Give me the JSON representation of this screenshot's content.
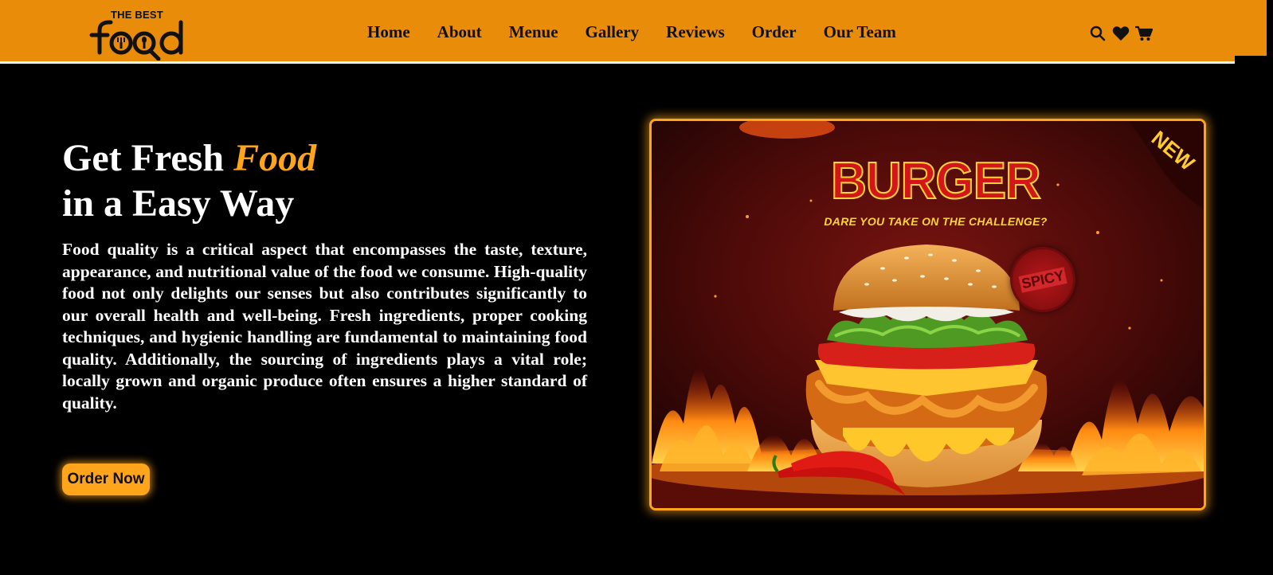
{
  "logo": {
    "top_text": "THE BEST",
    "main_text": "food"
  },
  "nav": {
    "items": [
      {
        "label": "Home"
      },
      {
        "label": "About"
      },
      {
        "label": "Menue"
      },
      {
        "label": "Gallery"
      },
      {
        "label": "Reviews"
      },
      {
        "label": "Order"
      },
      {
        "label": "Our Team"
      }
    ]
  },
  "header_icons": [
    "search-icon",
    "heart-icon",
    "cart-icon"
  ],
  "hero": {
    "title_part1": "Get Fresh ",
    "title_accent": "Food",
    "title_line2": "in a Easy Way",
    "description": "Food quality is a critical aspect that encompasses the taste, texture, appearance, and nutritional value of the food we consume. High-quality food not only delights our senses but also contributes significantly to our overall health and well-being. Fresh ingredients, proper cooking techniques, and hygienic handling are fundamental to maintaining food quality. Additionally, the sourcing of ingredients plays a vital role; locally grown and organic produce often ensures a higher standard of quality.",
    "button_label": "Order Now"
  },
  "promo_image": {
    "headline": "BURGER",
    "tagline": "DARE YOU TAKE ON THE CHALLENGE?",
    "corner_badge": "NEW",
    "stamp": "SPICY"
  },
  "colors": {
    "header_bg": "#e98c0a",
    "page_bg": "#000000",
    "accent": "#ffa51c",
    "text_light": "#ffffff",
    "text_dark": "#111111"
  }
}
